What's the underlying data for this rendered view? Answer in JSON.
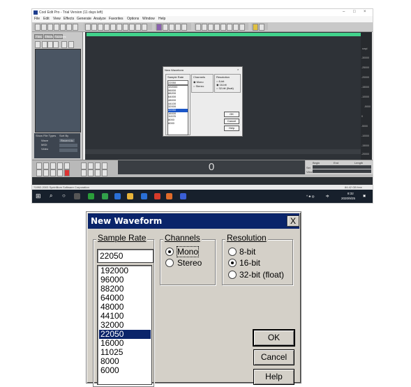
{
  "screenshot": {
    "window_title": "Cool Edit Pro - Trial Version (11 days left)",
    "menu": [
      "File",
      "Edit",
      "View",
      "Effects",
      "Generate",
      "Analyze",
      "Favorites",
      "Options",
      "Window",
      "Help"
    ],
    "left_panel": {
      "tabs": [
        "Files",
        "Effects",
        "Favorites"
      ],
      "show_file_types_label": "Show File Types",
      "sort_by_label": "Sort By",
      "file_types": [
        "Wave",
        "MIDI",
        "Video"
      ],
      "sort_value": "Recent Ac"
    },
    "counter_value": "0",
    "selection_headers": [
      "Begin",
      "End",
      "Length"
    ],
    "selection_rows": [
      "Sel",
      "View"
    ],
    "status_left": "?1992-2003 Syntrillium Software Corporation",
    "status_right": "84.42 GB free",
    "taskbar": {
      "time": "8:32",
      "date": "2020/9/25",
      "lang": "中"
    },
    "ruler_right": [
      "smpl",
      "-30000",
      "-25000",
      "-20000",
      "-15000",
      "-10000",
      "-5000",
      "0",
      "-5000",
      "-10000",
      "-15000",
      "-20000",
      "-25000",
      "-30000"
    ]
  },
  "dialog": {
    "title": "New Waveform",
    "close_label": "X",
    "sample_rate": {
      "group_label": "Sample Rate",
      "value": "22050",
      "options": [
        "192000",
        "96000",
        "88200",
        "64000",
        "48000",
        "44100",
        "32000",
        "22050",
        "16000",
        "11025",
        "8000",
        "6000"
      ],
      "selected": "22050"
    },
    "channels": {
      "group_label": "Channels",
      "options": [
        {
          "label": "Mono",
          "checked": true
        },
        {
          "label": "Stereo",
          "checked": false
        }
      ]
    },
    "resolution": {
      "group_label": "Resolution",
      "options": [
        {
          "label": "8-bit",
          "checked": false
        },
        {
          "label": "16-bit",
          "checked": true
        },
        {
          "label": "32-bit (float)",
          "checked": false
        }
      ]
    },
    "buttons": {
      "ok": "OK",
      "cancel": "Cancel",
      "help": "Help"
    }
  },
  "colors": {
    "titlebar_active": "#0a246a",
    "dialog_face": "#d4d0c8",
    "wave_background": "#2e3237",
    "overview_green": "#41d38c"
  }
}
